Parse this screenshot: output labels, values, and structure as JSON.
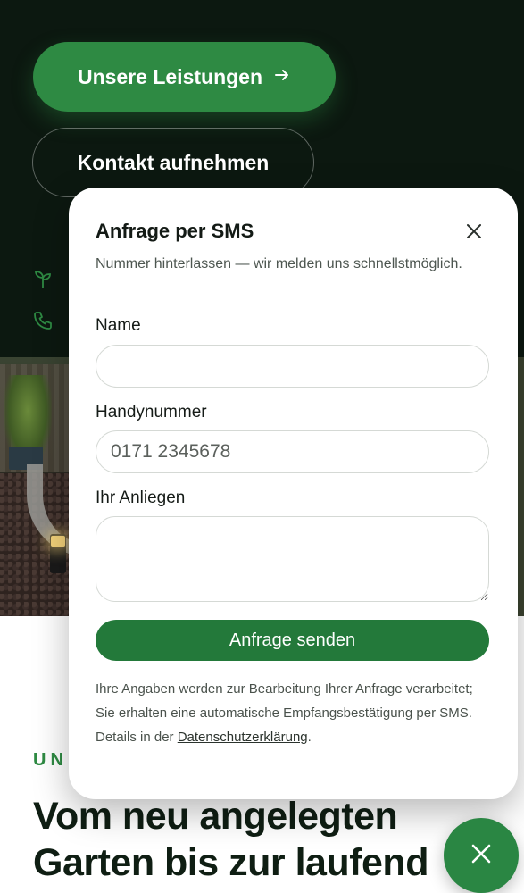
{
  "hero": {
    "primary_button_label": "Unsere Leistungen",
    "primary_button_icon": "arrow-right-icon",
    "secondary_button_label": "Kontakt aufnehmen"
  },
  "section": {
    "label": "UN",
    "title_line1": "Vom neu angelegten",
    "title_line2": "Garten bis zur laufend"
  },
  "sms_modal": {
    "title": "Anfrage per SMS",
    "close_icon": "close-icon",
    "subtitle": "Nummer hinterlassen — wir melden uns schnellstmöglich.",
    "name_label": "Name",
    "name_value": "",
    "phone_label": "Handynummer",
    "phone_placeholder": "0171 2345678",
    "message_label": "Ihr Anliegen",
    "message_value": "",
    "submit_label": "Anfrage senden",
    "privacy_text": "Ihre Angaben werden zur Bearbeitung Ihrer Anfrage verarbeitet; Sie erhalten eine automatische Empfangsbestätigung per SMS. Details in der ",
    "privacy_link": "Datenschutzerklärung",
    "privacy_end": "."
  },
  "fab": {
    "icon": "close-icon"
  },
  "colors": {
    "brand_green": "#2e8a43",
    "hero_background": "#0c1810"
  }
}
